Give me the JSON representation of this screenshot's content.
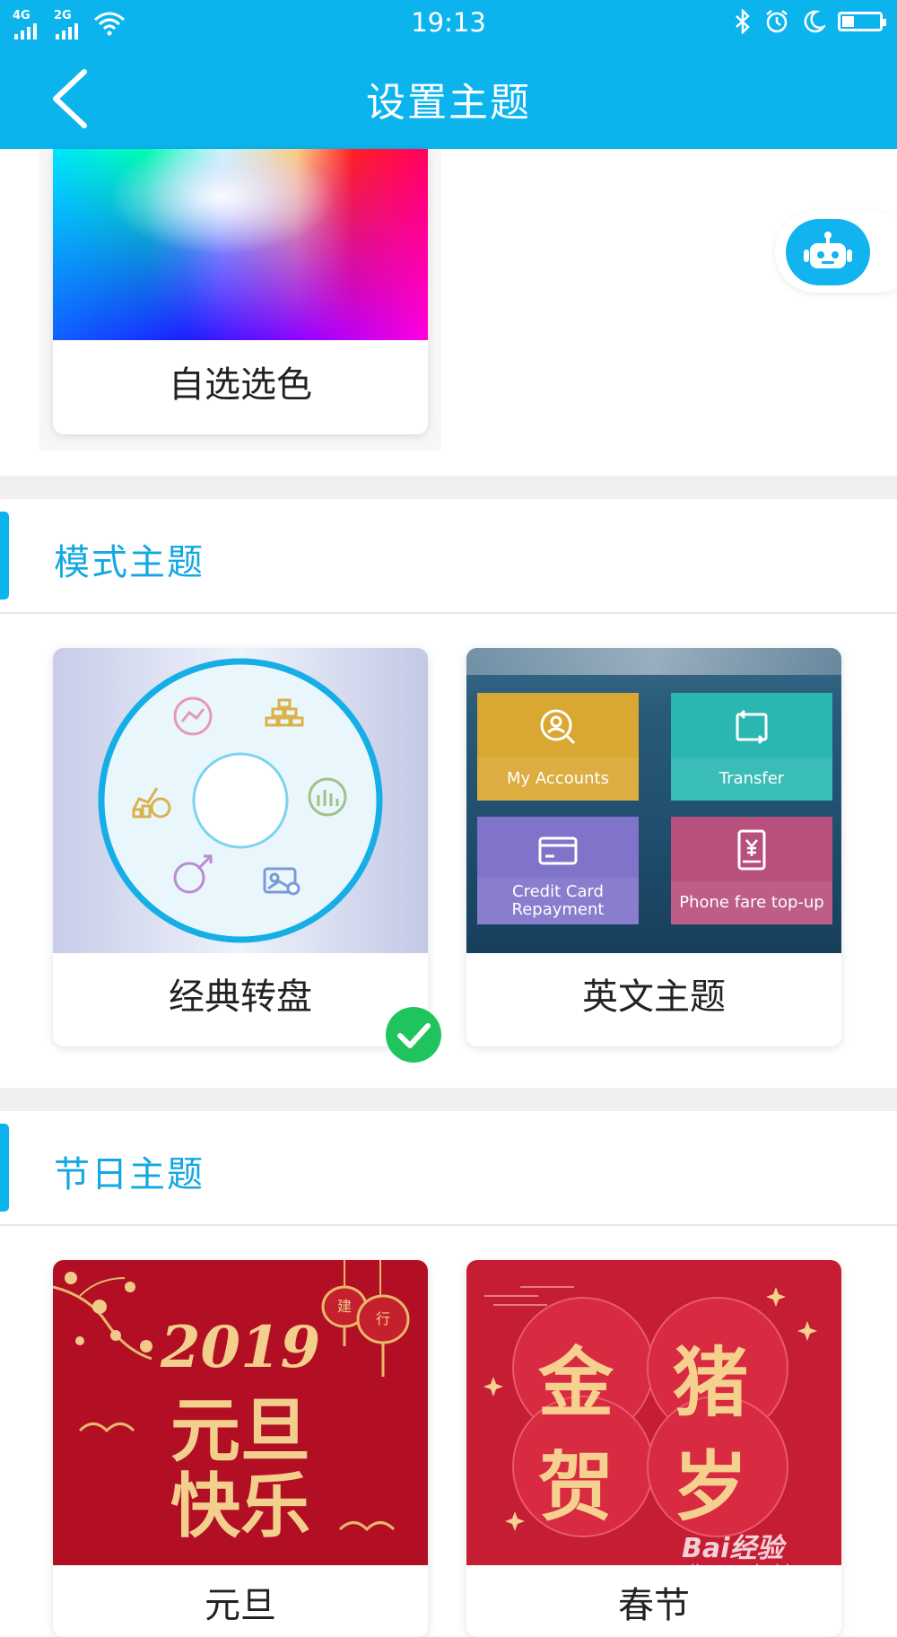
{
  "status_bar": {
    "network_1": "4G",
    "network_2": "2G",
    "time": "19:13",
    "battery_percent": 30
  },
  "nav": {
    "title": "设置主题"
  },
  "custom_color": {
    "label": "自选选色"
  },
  "sections": {
    "mode": {
      "title": "模式主题"
    },
    "holiday": {
      "title": "节日主题"
    }
  },
  "mode_themes": [
    {
      "label": "经典转盘",
      "selected": true
    },
    {
      "label": "英文主题",
      "selected": false
    }
  ],
  "english_theme_preview": {
    "tiles": [
      "My Accounts",
      "Transfer",
      "Credit Card Repayment",
      "Phone fare top-up"
    ],
    "tile_colors": [
      "#d9a832",
      "#2ab7b2",
      "#7f74c9",
      "#b8507e"
    ]
  },
  "holiday_themes": [
    {
      "label": "元旦",
      "art_text_1": "2019",
      "art_text_2": "元旦",
      "art_text_3": "快乐"
    },
    {
      "label": "春节",
      "art_chars": [
        "金",
        "猪",
        "贺",
        "岁"
      ]
    }
  ],
  "lantern_chars": [
    "建",
    "行"
  ],
  "watermark": {
    "logo": "Bai经验",
    "url": "jingyan.baidu.com"
  },
  "colors": {
    "brand": "#0cb4ee",
    "section_title": "#13a8e3",
    "check": "#1fc45e",
    "holiday_red": "#b20f24"
  }
}
